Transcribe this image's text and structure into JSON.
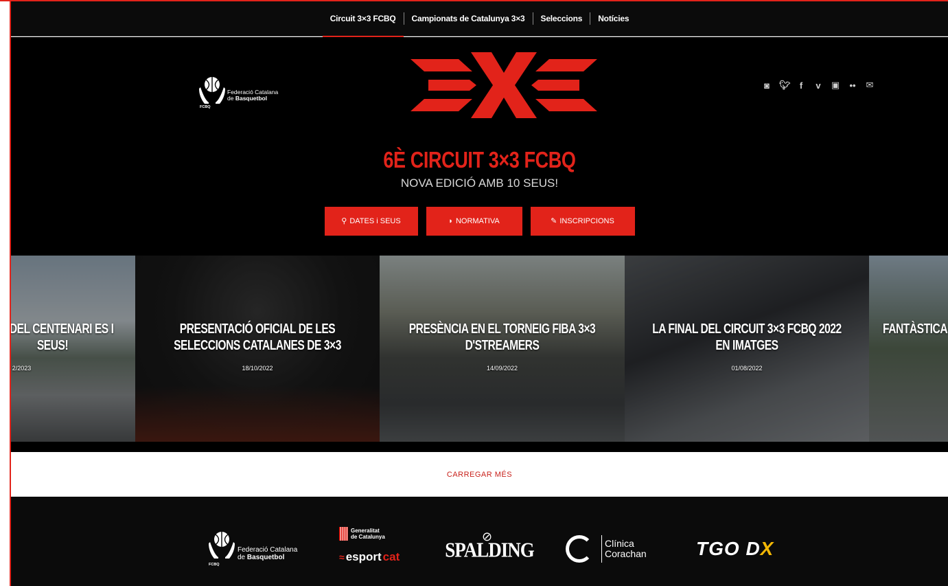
{
  "nav": {
    "items": [
      {
        "label": "Circuit 3×3 FCBQ",
        "active": true
      },
      {
        "label": "Campionats de Catalunya 3×3",
        "active": false
      },
      {
        "label": "Seleccions",
        "active": false
      },
      {
        "label": "Notícies",
        "active": false
      }
    ]
  },
  "header": {
    "fcbq_line1": "Federació Catalana",
    "fcbq_line2_prefix": "de ",
    "fcbq_line2_bold": "Basquetbol",
    "fcbq_abbr": "FCBQ",
    "social_icons": [
      "instagram-icon",
      "twitter-icon",
      "facebook-icon",
      "vimeo-icon",
      "youtube-icon",
      "flickr-icon",
      "mail-icon"
    ]
  },
  "hero": {
    "title": "6È CIRCUIT 3×3 FCBQ",
    "subtitle": "NOVA EDICIÓ AMB 10 SEUS!",
    "buttons": [
      {
        "label": "DATES i SEUS",
        "icon": "map-pin-icon"
      },
      {
        "label": "NORMATIVA",
        "icon": "whistle-icon"
      },
      {
        "label": "INSCRIPCIONS",
        "icon": "pencil-icon"
      }
    ]
  },
  "slider": {
    "slides": [
      {
        "caption": "BQ DEL CENTENARI ES I SEUS!",
        "date": "2/2023"
      },
      {
        "caption": "PRESENTACIÓ OFICIAL DE LES SELECCIONS CATALANES DE 3×3",
        "date": "18/10/2022"
      },
      {
        "caption": "PRESÈNCIA EN EL TORNEIG FIBA 3×3 D'STREAMERS",
        "date": "14/09/2022"
      },
      {
        "caption": "LA FINAL DEL CIRCUIT 3×3 FCBQ 2022 EN IMATGES",
        "date": "01/08/2022"
      },
      {
        "caption": "FANTÀSTICA",
        "date": ""
      }
    ]
  },
  "load_more": {
    "label": "CARREGAR MÉS"
  },
  "footer": {
    "fcbq_line1": "Federació Catalana",
    "fcbq_line2_prefix": "de ",
    "fcbq_line2_bold": "Basquetbol",
    "fcbq_abbr": "FCBQ",
    "generalitat_line1": "Generalitat",
    "generalitat_line2": "de Catalunya",
    "esport": "esport",
    "cat": "cat",
    "spalding": "SPALDING",
    "clinica_line1": "Clínica",
    "clinica_line2": "Corachan",
    "tgo": "TGO D",
    "tgo_x": "X"
  },
  "colors": {
    "accent": "#e2231a",
    "background": "#000000",
    "text": "#ffffff"
  }
}
